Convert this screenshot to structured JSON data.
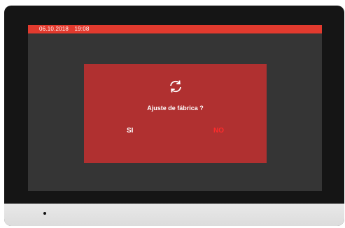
{
  "status_bar": {
    "date": "06.10.2018",
    "time": "19:08"
  },
  "dialog": {
    "icon": "refresh-icon",
    "title": "Ajuste de fábrica ?",
    "yes_label": "SI",
    "no_label": "NO"
  },
  "colors": {
    "accent": "#e23a2e",
    "dialog_bg": "#b03030",
    "screen_bg": "#353535",
    "no_text": "#ff2b2b"
  }
}
